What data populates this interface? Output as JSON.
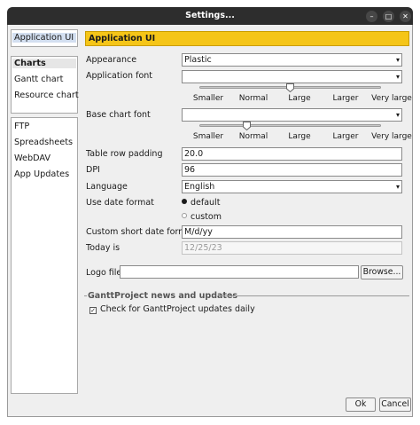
{
  "window": {
    "title": "Settings..."
  },
  "sidebar": {
    "top_items": [
      {
        "label": "Application UI"
      }
    ],
    "chart_items": [
      {
        "label": "Charts"
      },
      {
        "label": "Gantt chart"
      },
      {
        "label": "Resource chart"
      }
    ],
    "other_items": [
      {
        "label": "FTP"
      },
      {
        "label": "Spreadsheets"
      },
      {
        "label": "WebDAV"
      },
      {
        "label": "App Updates"
      }
    ]
  },
  "main": {
    "header": "Application UI",
    "appearance": {
      "label": "Appearance",
      "value": "Plastic"
    },
    "app_font": {
      "label": "Application font",
      "value": "",
      "size_level": 0.5
    },
    "base_font": {
      "label": "Base chart font",
      "value": "",
      "size_level": 0.25
    },
    "size_ticks": [
      "Smaller",
      "Normal",
      "Large",
      "Larger",
      "Very large"
    ],
    "row_padding": {
      "label": "Table row padding",
      "value": "20.0"
    },
    "dpi": {
      "label": "DPI",
      "value": "96"
    },
    "language": {
      "label": "Language",
      "value": "English"
    },
    "date_format": {
      "label": "Use date format",
      "options": [
        "default",
        "custom"
      ],
      "selected": "default"
    },
    "short_date": {
      "label": "Custom short date format",
      "value": "M/d/yy"
    },
    "today": {
      "label": "Today is",
      "value": "12/25/23"
    },
    "logo": {
      "label": "Logo file",
      "value": "",
      "browse": "Browse..."
    },
    "news": {
      "title": "GanttProject news and updates",
      "check_label": "Check for GanttProject updates daily",
      "checked": true
    }
  },
  "footer": {
    "ok": "Ok",
    "cancel": "Cancel"
  },
  "colors": {
    "header_bar": "#f5c518",
    "selected_item": "#d3dff0",
    "titlebar": "#2d2d2d"
  }
}
